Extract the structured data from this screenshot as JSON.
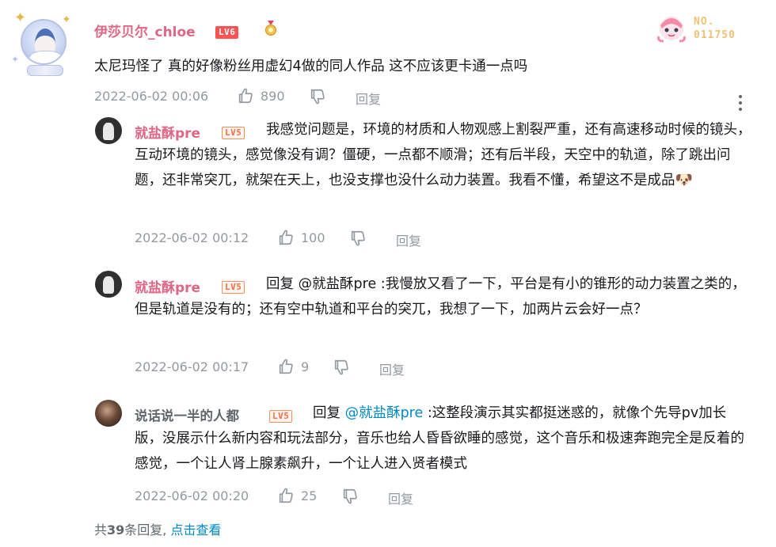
{
  "main_comment": {
    "username": "伊莎贝尔_chloe",
    "level": "LV6",
    "level_number": "6",
    "content": "太尼玛怪了 真的好像粉丝用虚幻4做的同人作品 这不应该更卡通一点吗",
    "time": "2022-06-02 00:06",
    "likes": "890",
    "reply_label": "回复",
    "fan_badge_no": "NO.",
    "fan_badge_number": "011750"
  },
  "replies": [
    {
      "username": "就盐酥pre",
      "level": "LV5",
      "content": "我感觉问题是，环境的材质和人物观感上割裂严重，还有高速移动时候的镜头，互动环境的镜头，感觉像没有调？僵硬，一点都不顺滑；还有后半段，天空中的轨道，除了跳出问题，还非常突兀，就架在天上，也没支撑也没什么动力装置。我看不懂，希望这不是成品",
      "emoji": "🐶",
      "time": "2022-06-02 00:12",
      "likes": "100",
      "reply_label": "回复"
    },
    {
      "username": "就盐酥pre",
      "level": "LV5",
      "content_prefix": "回复 @就盐酥pre :",
      "content": "我慢放又看了一下，平台是有小的锥形的动力装置之类的，但是轨道是没有的；还有空中轨道和平台的突兀，我想了一下，加两片云会好一点？",
      "time": "2022-06-02 00:17",
      "likes": "9",
      "reply_label": "回复"
    },
    {
      "username": "说话说一半的人都",
      "level": "LV5",
      "content_reply_word": "回复",
      "content_mention": "@就盐酥pre",
      "content": ":这整段演示其实都挺迷惑的，就像个先导pv加长版，没展示什么新内容和玩法部分，音乐也给人昏昏欲睡的感觉，这个音乐和极速奔跑完全是反着的感觉，一个让人肾上腺素飙升，一个让人进入贤者模式",
      "time": "2022-06-02 00:20",
      "likes": "25",
      "reply_label": "回复"
    }
  ],
  "footer": {
    "count_prefix": "共",
    "count": "39",
    "count_suffix": "条回复,",
    "view_link": "点击查看"
  },
  "colors": {
    "username_pink": "#e06686",
    "username_gray": "#61666d",
    "meta_gray": "#9499a0",
    "link_blue": "#008ac5",
    "lv6_red": "#ff5252",
    "lv5_orange": "#ff6b40"
  }
}
